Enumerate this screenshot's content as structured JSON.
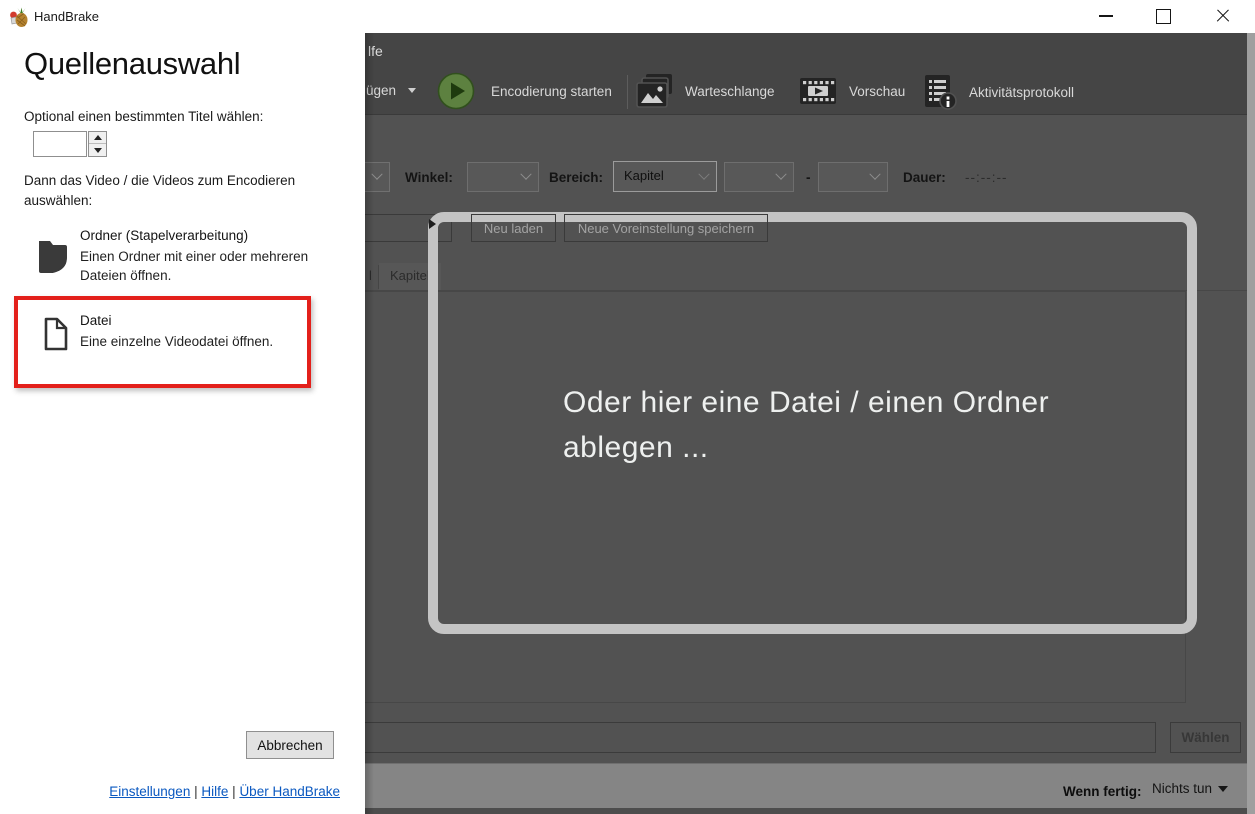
{
  "titlebar": {
    "app_title": "HandBrake"
  },
  "menubar": {
    "partial_item": "lfe"
  },
  "toolbar": {
    "add_partial": "ügen",
    "start_encode": "Encodierung starten",
    "queue": "Warteschlange",
    "preview": "Vorschau",
    "activity_log": "Aktivitätsprotokoll"
  },
  "source_controls": {
    "angle_label": "Winkel:",
    "range_label": "Bereich:",
    "range_type": "Kapitel",
    "range_separator": "-",
    "duration_label": "Dauer:",
    "duration_value": "--:--:--"
  },
  "presets": {
    "reload": "Neu laden",
    "save": "Neue Voreinstellung speichern"
  },
  "tabs": {
    "partial_tab": "l",
    "chapters_tab": "Kapitel"
  },
  "drop_zone": {
    "line1": "Oder hier eine Datei / einen Ordner",
    "line2": "ablegen ..."
  },
  "destination": {
    "path": "",
    "choose": "Wählen"
  },
  "statusbar": {
    "when_done_label": "Wenn fertig:",
    "when_done_value": "Nichts tun"
  },
  "source_panel": {
    "heading": "Quellenauswahl",
    "title_option_label": "Optional einen bestimmten Titel wählen:",
    "title_value": "",
    "instruction_line1": "Dann das Video / die Videos zum Encodieren",
    "instruction_line2": "auswählen:",
    "folder_option": {
      "title": "Ordner (Stapelverarbeitung)",
      "desc_line1": "Einen Ordner mit einer oder mehreren",
      "desc_line2": "Dateien öffnen."
    },
    "file_option": {
      "title": "Datei",
      "desc": "Eine einzelne Videodatei öffnen."
    },
    "cancel": "Abbrechen",
    "links": {
      "settings": "Einstellungen",
      "help": "Hilfe",
      "about": "Über HandBrake",
      "separator": "|"
    }
  },
  "colors": {
    "highlight_red": "#e3201b",
    "start_green": "#5d8140",
    "link_blue": "#0a58c0",
    "overlay_gray": "#525252",
    "drop_border": "#c4c4c4"
  }
}
